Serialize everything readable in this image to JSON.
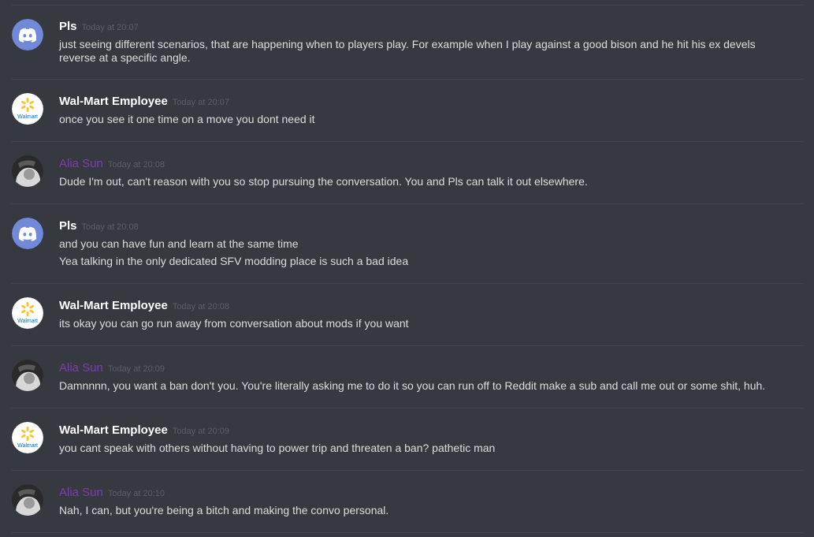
{
  "colors": {
    "background": "#36393f",
    "divider": "#40434a",
    "username_default": "#ffffff",
    "username_role": "#7a3fae",
    "timestamp": "#5b5e64",
    "message_text": "#dcddde",
    "discord_blurple": "#7289da",
    "walmart_yellow": "#ffc220",
    "walmart_blue": "#0071ce"
  },
  "messages": [
    {
      "author": "Pls",
      "avatar": "discord-logo-icon",
      "time": "Today at 20:07",
      "lines": [
        "just seeing different scenarios, that are happening when to players play. For example when I play against a good bison and he hit his ex devels reverse at a specific angle."
      ]
    },
    {
      "author": "Wal-Mart Employee",
      "avatar": "walmart-logo-icon",
      "avatar_text": "Walmart",
      "time": "Today at 20:07",
      "lines": [
        "once you see it one time on a move you dont need it"
      ]
    },
    {
      "author": "Alia Sun",
      "avatar": "bw-photo-icon",
      "time": "Today at 20:08",
      "lines": [
        "Dude I'm out, can't reason with you so stop pursuing the conversation. You and Pls can talk it out elsewhere."
      ]
    },
    {
      "author": "Pls",
      "avatar": "discord-logo-icon",
      "time": "Today at 20:08",
      "lines": [
        "and you can have fun and learn at the same time",
        "Yea talking in the only dedicated SFV modding place is such a bad idea"
      ]
    },
    {
      "author": "Wal-Mart Employee",
      "avatar": "walmart-logo-icon",
      "avatar_text": "Walmart",
      "time": "Today at 20:08",
      "lines": [
        "its okay you can go run away from conversation about mods if you want"
      ]
    },
    {
      "author": "Alia Sun",
      "avatar": "bw-photo-icon",
      "time": "Today at 20:09",
      "lines": [
        "Damnnnn, you want a ban don't you. You're literally asking me to do it so you can run off to Reddit make a sub and call me out or some shit, huh."
      ]
    },
    {
      "author": "Wal-Mart Employee",
      "avatar": "walmart-logo-icon",
      "avatar_text": "Walmart",
      "time": "Today at 20:09",
      "lines": [
        "you cant speak with others without having to power trip and threaten a ban? pathetic man"
      ]
    },
    {
      "author": "Alia Sun",
      "avatar": "bw-photo-icon",
      "time": "Today at 20:10",
      "lines": [
        "Nah, I can, but you're being a bitch and making the convo personal."
      ]
    }
  ]
}
